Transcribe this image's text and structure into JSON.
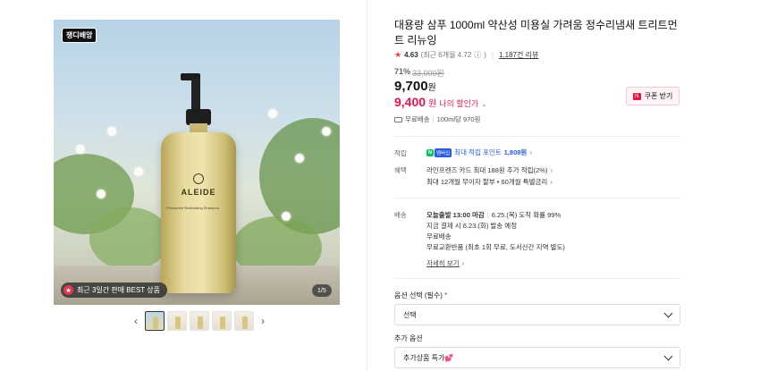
{
  "gallery": {
    "top_badge": "쟁디배앙",
    "brand_on_bottle": "ALEIDE",
    "bottle_subtext": "Provincare Restorating Shampoo",
    "best_label": "최근 3일간 판매 BEST 상품",
    "page_indicator": "1/5",
    "prev_arrow": "‹",
    "next_arrow": "›",
    "thumb_count": 5
  },
  "product": {
    "title": "대용량 삼푸 1000ml 약산성 미용실 가려움 정수리냄새 트리트먼트 리뉴잉",
    "rating": {
      "star": "★",
      "score": "4.63",
      "recent": "(최근 6개월 4.72",
      "recent_close": ")",
      "reviews": "1,187건 리뷰"
    },
    "discount_pct": "71%",
    "original_price": "33,000원",
    "price": "9,700",
    "price_unit": "원",
    "my_price": "9,400",
    "my_price_unit": "원",
    "my_price_label": "나의 할인가",
    "coupon_button": "쿠폰 받기",
    "shipping_summary": "무료배송",
    "unit_price": "100ml당 970원"
  },
  "benefits": {
    "points_label": "적립",
    "points_npay": "N",
    "points_badge": "멤버십",
    "points_text": "최대 적립 포인트",
    "points_value": "1,808원",
    "perks_label": "혜택",
    "perk_1": "라인프렌즈 카드 최대 188원 추가 적립(2%)",
    "perk_2": "최대 12개월 무이자 할부 • 60개월 특별금리"
  },
  "delivery": {
    "label": "배송",
    "today": "오늘출발 13:00 마감",
    "arrival": "6.25.(목) 도착 확률 99%",
    "pay_now": "지금 결제 시 6.23.(화) 발송 예정",
    "free": "무료배송",
    "returns": "무료교환반품 (최초 1회 무료, 도서산간 지역 별도)",
    "more_link": "자세히 보기"
  },
  "options": {
    "select_label": "옵션 선택 (필수)",
    "required_mark": "*",
    "select_value": "선택",
    "extra_label": "추가 옵션",
    "extra_value": "추가상품 특가"
  }
}
